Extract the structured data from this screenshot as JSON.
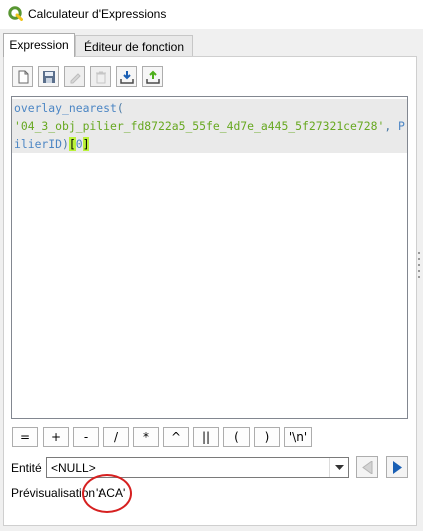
{
  "window": {
    "title": "Calculateur d'Expressions"
  },
  "tabs": [
    {
      "label": "Expression",
      "active": true
    },
    {
      "label": "Éditeur de fonction",
      "active": false
    }
  ],
  "toolbar": {
    "buttons": [
      {
        "icon": "new-file-icon",
        "enabled": true
      },
      {
        "icon": "save-icon",
        "enabled": true
      },
      {
        "icon": "edit-icon",
        "enabled": false
      },
      {
        "icon": "delete-icon",
        "enabled": false
      },
      {
        "icon": "import-icon",
        "enabled": true
      },
      {
        "icon": "export-icon",
        "enabled": true
      }
    ]
  },
  "editor": {
    "tokens": {
      "fn": "overlay_nearest",
      "open_paren": "(",
      "string": "'04_3_obj_pilier_fd8722a5_55fe_4d7e_a445_5f27321ce728'",
      "comma": ", ",
      "field": "PilierID",
      "close_paren": ")",
      "bracket_open": "[",
      "index": "0",
      "bracket_close": "]"
    },
    "highlight_color": "#baf23a"
  },
  "operators": [
    "=",
    "+",
    "-",
    "/",
    "*",
    "^",
    "||",
    "(",
    ")",
    "'\\n'"
  ],
  "entity": {
    "label": "Entité",
    "value": "<NULL>"
  },
  "preview": {
    "label": "Prévisualisation :",
    "value": "'ACA'"
  },
  "colors": {
    "accent": "#1a5fb4",
    "annotation": "#d62020"
  }
}
